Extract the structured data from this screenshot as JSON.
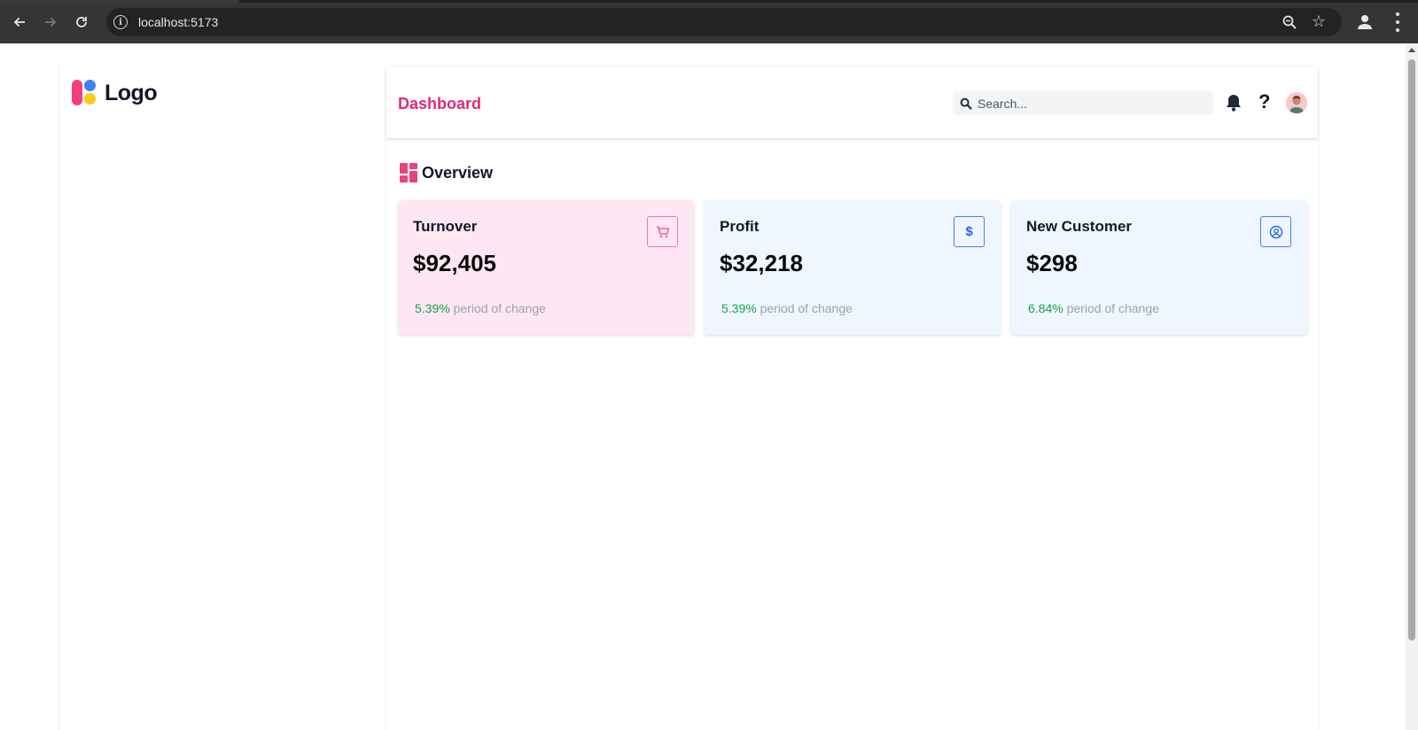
{
  "browser": {
    "url": "localhost:5173"
  },
  "sidebar": {
    "logo_text": "Logo"
  },
  "header": {
    "title": "Dashboard",
    "search_placeholder": "Search...",
    "help_label": "?"
  },
  "overview": {
    "title": "Overview",
    "cards": [
      {
        "title": "Turnover",
        "value": "$92,405",
        "change_pct": "5.39%",
        "change_label": "period of change",
        "icon": "cart-icon",
        "theme": "pink"
      },
      {
        "title": "Profit",
        "value": "$32,218",
        "change_pct": "5.39%",
        "change_label": "period of change",
        "icon": "dollar-icon",
        "icon_text": "$",
        "theme": "blue"
      },
      {
        "title": "New Customer",
        "value": "$298",
        "change_pct": "6.84%",
        "change_label": "period of change",
        "icon": "user-circle-icon",
        "theme": "blue"
      }
    ]
  },
  "colors": {
    "accent_pink": "#e0287a",
    "positive_green": "#16a34a",
    "card_pink_bg": "#fce7f3",
    "card_blue_bg": "#eff6ff"
  }
}
